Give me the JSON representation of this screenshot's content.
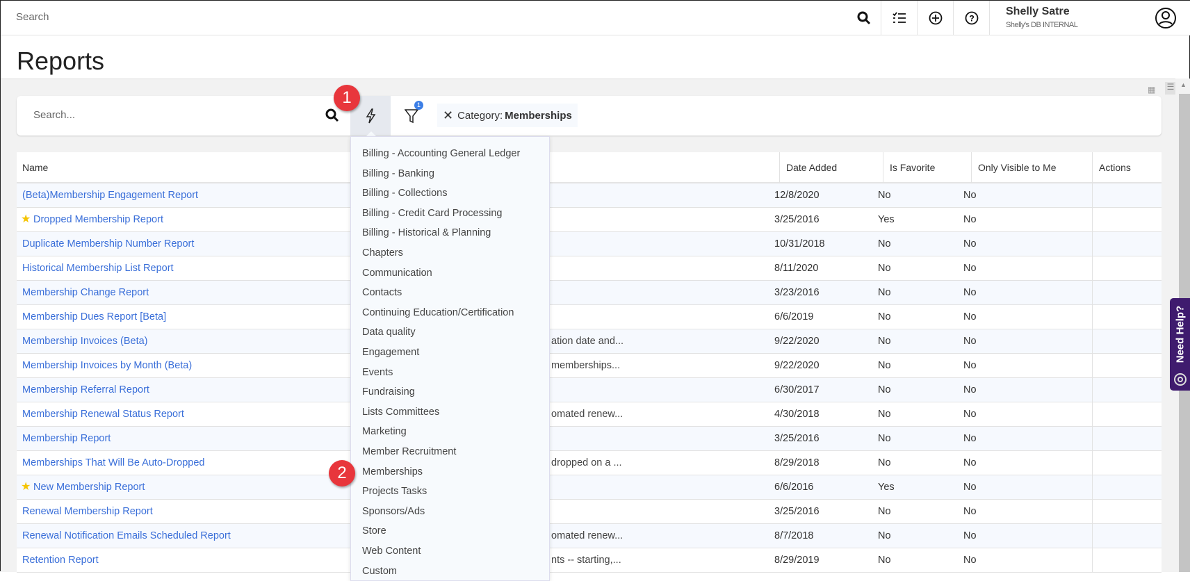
{
  "topbar": {
    "search_placeholder": "Search",
    "user_name": "Shelly Satre",
    "user_db": "Shelly's DB INTERNAL"
  },
  "page": {
    "title": "Reports"
  },
  "toolbar": {
    "search_placeholder": "Search...",
    "filter_count": "1",
    "chip_label": "Category:",
    "chip_value": "Memberships"
  },
  "table": {
    "headers": {
      "name": "Name",
      "date_added": "Date Added",
      "is_favorite": "Is Favorite",
      "only_visible": "Only Visible to Me",
      "actions": "Actions"
    },
    "rows": [
      {
        "name": "(Beta)Membership Engagement Report",
        "desc": "",
        "date": "12/8/2020",
        "fav": "No",
        "visible": "No",
        "star": false
      },
      {
        "name": "Dropped Membership Report",
        "desc": "",
        "date": "3/25/2016",
        "fav": "Yes",
        "visible": "No",
        "star": true
      },
      {
        "name": "Duplicate Membership Number Report",
        "desc": "",
        "date": "10/31/2018",
        "fav": "No",
        "visible": "No",
        "star": false
      },
      {
        "name": "Historical Membership List Report",
        "desc": "",
        "date": "8/11/2020",
        "fav": "No",
        "visible": "No",
        "star": false
      },
      {
        "name": "Membership Change Report",
        "desc": "",
        "date": "3/23/2016",
        "fav": "No",
        "visible": "No",
        "star": false
      },
      {
        "name": "Membership Dues Report [Beta]",
        "desc": "",
        "date": "6/6/2019",
        "fav": "No",
        "visible": "No",
        "star": false
      },
      {
        "name": "Membership Invoices (Beta)",
        "desc": "ation date and...",
        "date": "9/22/2020",
        "fav": "No",
        "visible": "No",
        "star": false
      },
      {
        "name": "Membership Invoices by Month (Beta)",
        "desc": "memberships...",
        "date": "9/22/2020",
        "fav": "No",
        "visible": "No",
        "star": false
      },
      {
        "name": "Membership Referral Report",
        "desc": "",
        "date": "6/30/2017",
        "fav": "No",
        "visible": "No",
        "star": false
      },
      {
        "name": "Membership Renewal Status Report",
        "desc": "omated renew...",
        "date": "4/30/2018",
        "fav": "No",
        "visible": "No",
        "star": false
      },
      {
        "name": "Membership Report",
        "desc": "",
        "date": "3/25/2016",
        "fav": "No",
        "visible": "No",
        "star": false
      },
      {
        "name": "Memberships That Will Be Auto-Dropped",
        "desc": "dropped on a ...",
        "date": "8/29/2018",
        "fav": "No",
        "visible": "No",
        "star": false
      },
      {
        "name": "New Membership Report",
        "desc": "",
        "date": "6/6/2016",
        "fav": "Yes",
        "visible": "No",
        "star": true
      },
      {
        "name": "Renewal Membership Report",
        "desc": "",
        "date": "3/25/2016",
        "fav": "No",
        "visible": "No",
        "star": false
      },
      {
        "name": "Renewal Notification Emails Scheduled Report",
        "desc": "omated renew...",
        "date": "8/7/2018",
        "fav": "No",
        "visible": "No",
        "star": false
      },
      {
        "name": "Retention Report",
        "desc": "nts -- starting,...",
        "date": "8/29/2019",
        "fav": "No",
        "visible": "No",
        "star": false
      }
    ]
  },
  "dropdown": {
    "items": [
      "Billing - Accounting General Ledger",
      "Billing - Banking",
      "Billing - Collections",
      "Billing - Credit Card Processing",
      "Billing - Historical & Planning",
      "Chapters",
      "Communication",
      "Contacts",
      "Continuing Education/Certification",
      "Data quality",
      "Engagement",
      "Events",
      "Fundraising",
      "Lists Committees",
      "Marketing",
      "Member Recruitment",
      "Memberships",
      "Projects Tasks",
      "Sponsors/Ads",
      "Store",
      "Web Content",
      "Custom"
    ]
  },
  "annotations": {
    "step1": "1",
    "step2": "2"
  },
  "help": {
    "label": "Need Help?"
  },
  "colors": {
    "link": "#3a6fd9",
    "badge": "#e8363c",
    "help": "#3f1b6e"
  }
}
